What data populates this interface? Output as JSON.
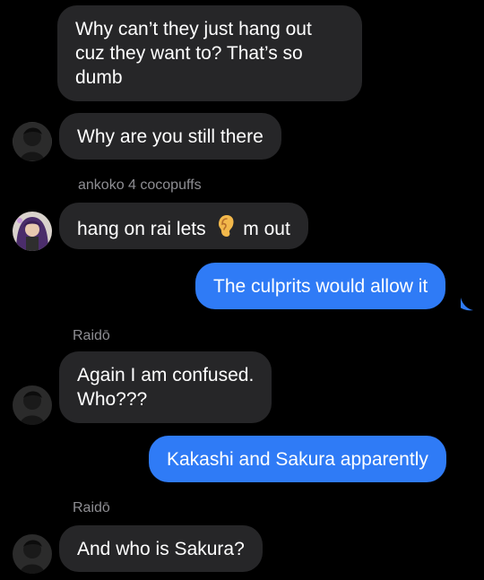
{
  "messages": [
    {
      "id": "m1",
      "direction": "incoming",
      "lines": [
        "Why can’t they just hang out",
        "cuz they want to? That’s so",
        "dumb"
      ]
    },
    {
      "id": "m2",
      "direction": "incoming",
      "text": "Why are you still there"
    },
    {
      "id": "m3",
      "direction": "incoming",
      "sender": "ankoko 4 cocopuffs",
      "text_before": "hang on rai lets",
      "emoji": "ear",
      "text_after": "m out"
    },
    {
      "id": "m4",
      "direction": "outgoing",
      "text": "The culprits would allow it"
    },
    {
      "id": "m5",
      "direction": "incoming",
      "sender": "Raidō",
      "lines": [
        "Again I am confused.",
        "Who???"
      ]
    },
    {
      "id": "m6",
      "direction": "outgoing",
      "text": "Kakashi and Sakura apparently"
    },
    {
      "id": "m7",
      "direction": "incoming",
      "sender": "Raidō",
      "text": "And who is Sakura?"
    }
  ],
  "colors": {
    "background": "#000000",
    "incoming_bubble": "#262628",
    "outgoing_bubble": "#2f7bf6",
    "sender_text": "#8e8e93",
    "message_text": "#ffffff"
  },
  "icons": {
    "avatar_raido": "dark-portrait-avatar",
    "avatar_anko": "purple-hair-portrait-avatar",
    "emoji": "ear-emoji"
  }
}
